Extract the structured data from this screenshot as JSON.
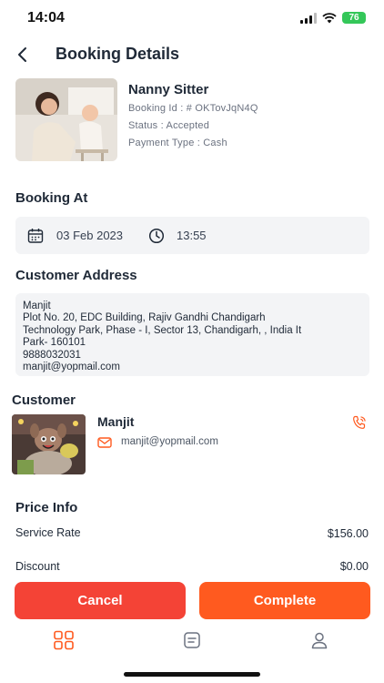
{
  "status_bar": {
    "time": "14:04",
    "battery": "76"
  },
  "header": {
    "title": "Booking Details"
  },
  "service": {
    "name": "Nanny Sitter",
    "booking_id": "Booking Id : # OKTovJqN4Q",
    "status": "Status : Accepted",
    "payment_type": "Payment Type : Cash"
  },
  "booking_at": {
    "title": "Booking At",
    "date": "03 Feb 2023",
    "time": "13:55"
  },
  "address": {
    "title": "Customer Address",
    "lines": [
      "Manjit",
      "Plot No. 20, EDC Building, Rajiv Gandhi Chandigarh",
      "Technology Park, Phase - I, Sector 13, Chandigarh, , India It",
      "Park- 160101",
      "9888032031",
      "manjit@yopmail.com"
    ]
  },
  "customer": {
    "title": "Customer",
    "name": "Manjit",
    "email": "manjit@yopmail.com"
  },
  "price_info": {
    "title": "Price Info",
    "rows": [
      {
        "label": "Service Rate",
        "value": "$156.00"
      },
      {
        "label": "Discount",
        "value": "$0.00"
      }
    ]
  },
  "actions": {
    "cancel_label": "Cancel",
    "complete_label": "Complete"
  },
  "nav": {
    "items": [
      "dashboard-icon",
      "bookings-icon",
      "profile-icon"
    ]
  },
  "colors": {
    "accent": "#ff5a1f",
    "cancel": "#f44336",
    "surface": "#f3f4f6"
  }
}
